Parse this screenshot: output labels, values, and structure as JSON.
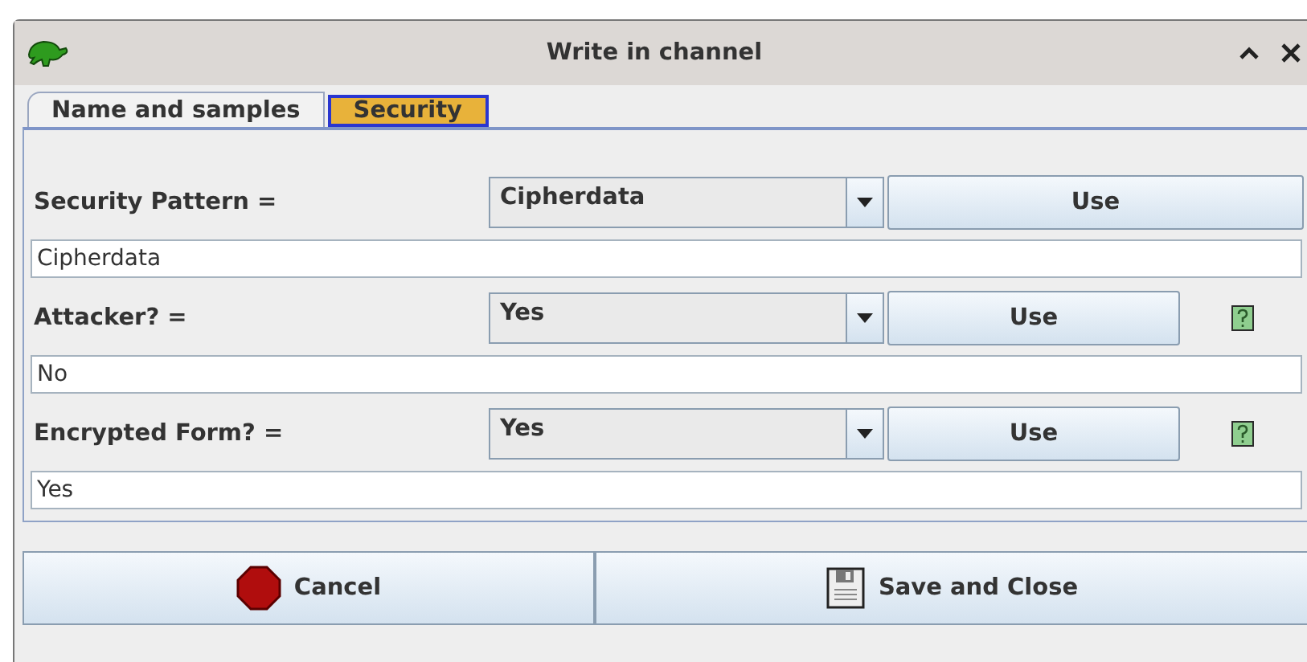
{
  "window": {
    "title": "Write in channel"
  },
  "tabs": [
    {
      "label": "Name and samples",
      "selected": false
    },
    {
      "label": "Security",
      "selected": true
    }
  ],
  "rows": [
    {
      "label": "Security Pattern =",
      "choice": "Cipherdata",
      "button": "Use",
      "value": "Cipherdata",
      "help": false
    },
    {
      "label": "Attacker? =",
      "choice": "Yes",
      "button": "Use",
      "value": "No",
      "help": true
    },
    {
      "label": "Encrypted Form? =",
      "choice": "Yes",
      "button": "Use",
      "value": "Yes",
      "help": true
    }
  ],
  "buttons": [
    {
      "kind": "cancel",
      "label": "Cancel"
    },
    {
      "kind": "save",
      "label": "Save and Close"
    }
  ]
}
